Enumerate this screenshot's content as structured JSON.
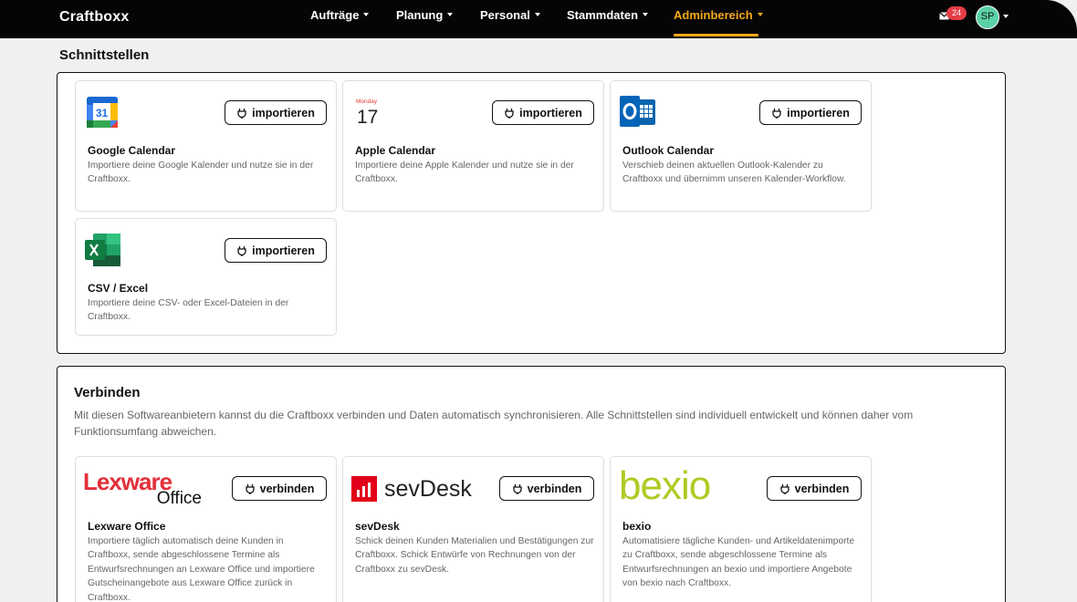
{
  "app": {
    "brand": "Craftboxx"
  },
  "nav": {
    "items": [
      {
        "label": "Aufträge"
      },
      {
        "label": "Planung"
      },
      {
        "label": "Personal"
      },
      {
        "label": "Stammdaten"
      },
      {
        "label": "Adminbereich",
        "active": true
      }
    ],
    "notification_count": "24",
    "avatar_initials": "SP",
    "accent_color": "#f5a81c"
  },
  "schnittstellen": {
    "title": "Schnittstellen",
    "cards": [
      {
        "title": "Google Calendar",
        "desc": "Importiere deine Google Kalender und nutze sie in der Craftboxx.",
        "button": "importieren",
        "icon": "google-calendar-logo"
      },
      {
        "title": "Apple Calendar",
        "desc": "Importiere deine Apple Kalender und nutze sie in der Craftboxx.",
        "button": "importieren",
        "icon": "apple-calendar-logo",
        "logo_month": "Monday",
        "logo_day": "17"
      },
      {
        "title": "Outlook Calendar",
        "desc": "Verschieb deinen aktuellen Outlook-Kalender zu Craftboxx und übernimm unseren Kalender-Workflow.",
        "button": "importieren",
        "icon": "outlook-logo"
      },
      {
        "title": "CSV / Excel",
        "desc": "Importiere deine CSV- oder Excel-Dateien in der Craftboxx.",
        "button": "importieren",
        "icon": "excel-logo"
      }
    ]
  },
  "verbinden": {
    "title": "Verbinden",
    "desc": "Mit diesen Softwareanbietern kannst du die Craftboxx verbinden und Daten automatisch synchronisieren. Alle Schnittstellen sind individuell entwickelt und können daher vom Funktionsumfang abweichen.",
    "cards": [
      {
        "title": "Lexware Office",
        "desc": "Importiere täglich automatisch deine Kunden in Craftboxx, sende abgeschlossene Termine als Entwurfsrechnungen an Lexware Office und importiere Gutscheinangebote aus Lexware Office zurück in Craftboxx.",
        "button": "verbinden",
        "logo_line1": "Lexware",
        "logo_line2": "Office"
      },
      {
        "title": "sevDesk",
        "desc": "Schick deinen Kunden Materialien und Bestätigungen zur Craftboxx. Schick Entwürfe von Rechnungen von der Craftboxx zu sevDesk.",
        "button": "verbinden",
        "logo_text": "sevDesk"
      },
      {
        "title": "bexio",
        "desc": "Automatisiere tägliche Kunden- und Artikeldatenimporte zu Craftboxx, sende abgeschlossene Termine als Entwurfsrechnungen an bexio und importiere Angebote von bexio nach Craftboxx.",
        "button": "verbinden",
        "logo_text": "bexio"
      }
    ]
  }
}
